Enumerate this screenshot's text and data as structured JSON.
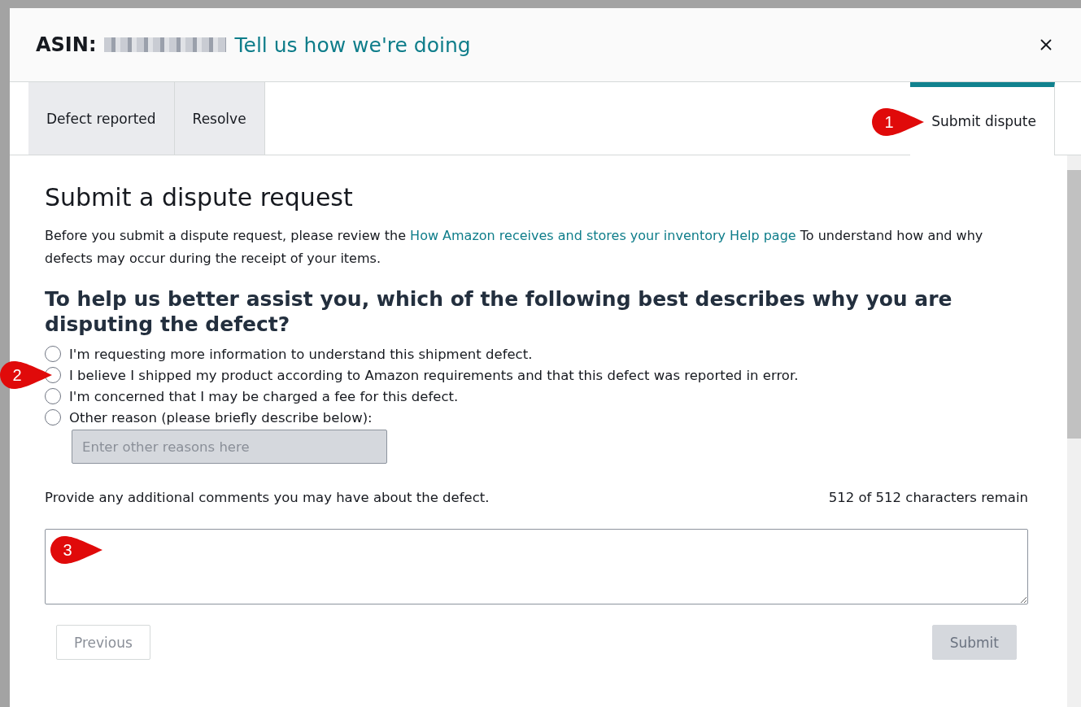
{
  "header": {
    "label": "ASIN:",
    "link": "Tell us how we're doing"
  },
  "tabs": [
    {
      "label": "Defect reported",
      "selected": false
    },
    {
      "label": "Resolve",
      "selected": false
    },
    {
      "label": "Submit dispute",
      "selected": true,
      "callout": "1"
    }
  ],
  "heading": "Submit a dispute request",
  "intro": {
    "before": "Before you submit a dispute request, please review the",
    "link": "How Amazon receives and stores your inventory Help page",
    "after": "To understand how and why defects may occur during the receipt of your items."
  },
  "question": "To help us better assist you, which of the following best describes why you are disputing the defect?",
  "options": [
    {
      "label": "I'm requesting more information to understand this shipment defect.",
      "selected": false
    },
    {
      "label": "I believe I shipped my product according to Amazon requirements and that this defect was reported in error.",
      "selected": false,
      "callout": "2"
    },
    {
      "label": "I'm concerned that I may be charged a fee for this defect.",
      "selected": false
    },
    {
      "label": "Other reason (please briefly describe below):",
      "selected": false
    }
  ],
  "other_field": {
    "placeholder": "Enter other reasons here",
    "disabled": true
  },
  "comments": {
    "label": "Provide any additional comments you may have about the defect.",
    "counter": "512 of 512 characters remain",
    "callout": "3"
  },
  "buttons": [
    {
      "label": "Previous",
      "kind": "secondary",
      "disabled": true
    },
    {
      "label": "Submit",
      "kind": "primary",
      "disabled": true
    }
  ]
}
